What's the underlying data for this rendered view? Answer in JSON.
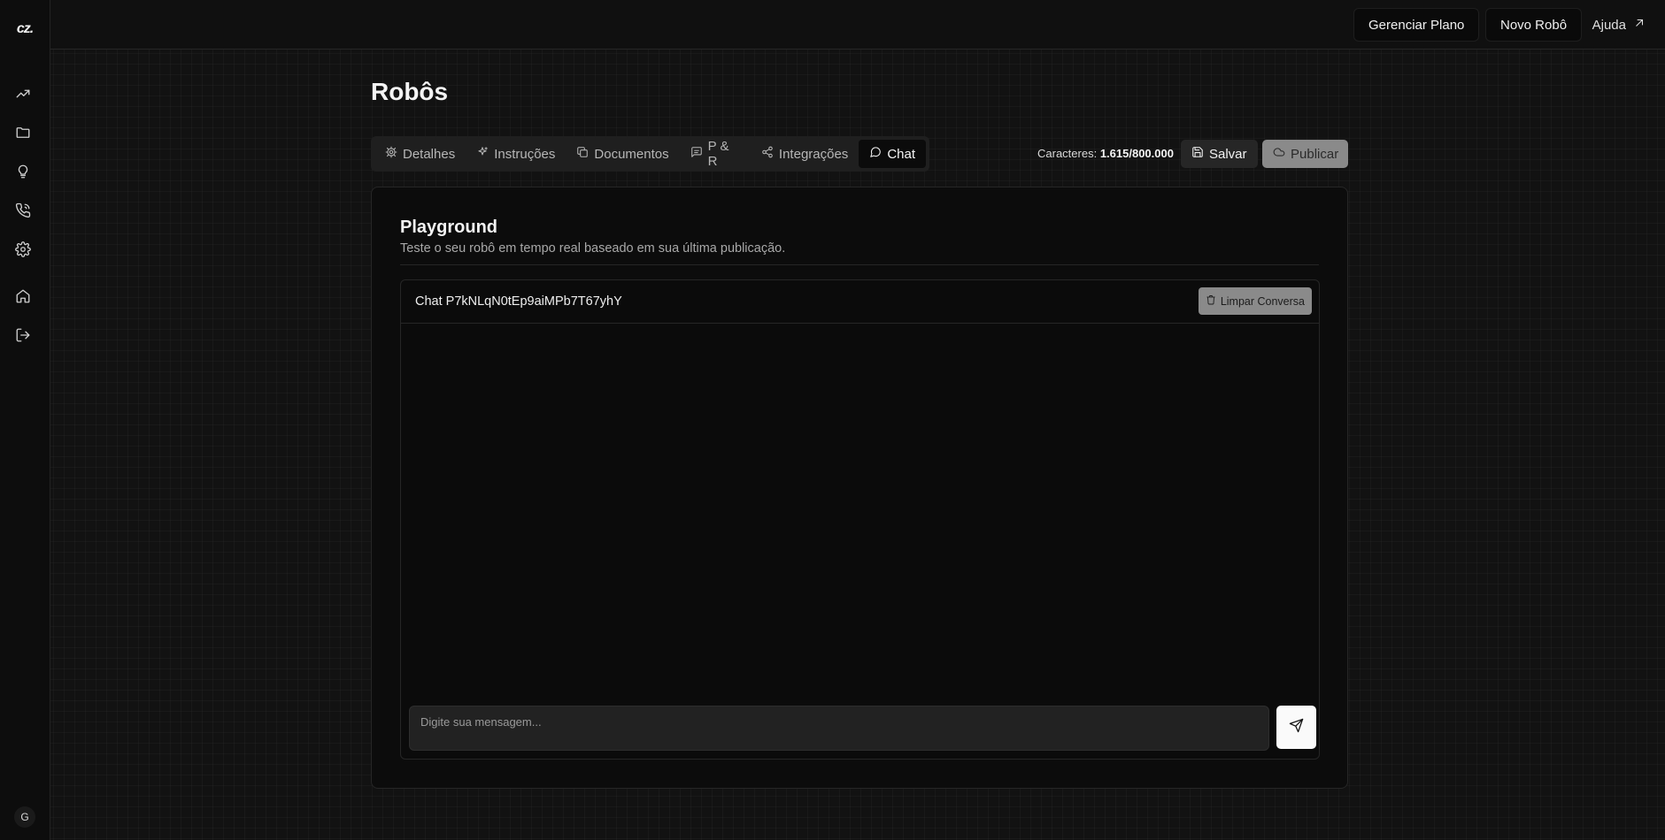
{
  "app": {
    "logo_text": "cz."
  },
  "sidebar": {
    "icons": [
      {
        "name": "trending-up-icon"
      },
      {
        "name": "folder-icon"
      },
      {
        "name": "lightbulb-icon"
      },
      {
        "name": "phone-icon"
      },
      {
        "name": "gear-icon"
      },
      {
        "name": "home-icon"
      },
      {
        "name": "logout-icon"
      }
    ],
    "avatar_initial": "G"
  },
  "topbar": {
    "manage_plan_label": "Gerenciar Plano",
    "new_robot_label": "Novo Robô",
    "help_label": "Ajuda"
  },
  "page": {
    "title": "Robôs"
  },
  "tabs": [
    {
      "label": "Detalhes",
      "icon": "gear-icon",
      "active": false
    },
    {
      "label": "Instruções",
      "icon": "sparkles-icon",
      "active": false
    },
    {
      "label": "Documentos",
      "icon": "copy-icon",
      "active": false
    },
    {
      "label": "P & R",
      "icon": "message-square-icon",
      "active": false
    },
    {
      "label": "Integrações",
      "icon": "share-icon",
      "active": false
    },
    {
      "label": "Chat",
      "icon": "message-circle-icon",
      "active": true
    }
  ],
  "toolbar": {
    "char_label": "Caracteres:",
    "char_value": "1.615/800.000",
    "save_label": "Salvar",
    "publish_label": "Publicar"
  },
  "playground": {
    "title": "Playground",
    "subtitle": "Teste o seu robô em tempo real baseado em sua última publicação.",
    "chat_id": "Chat P7kNLqN0tEp9aiMPb7T67yhY",
    "clear_label": "Limpar Conversa",
    "input_placeholder": "Digite sua mensagem...",
    "input_value": ""
  },
  "colors": {
    "background": "#121212",
    "surface": "#0c0c0c",
    "tab_bar": "#1f1f1f",
    "muted_button": "#8a8a8a",
    "send_button": "#fafafa"
  }
}
